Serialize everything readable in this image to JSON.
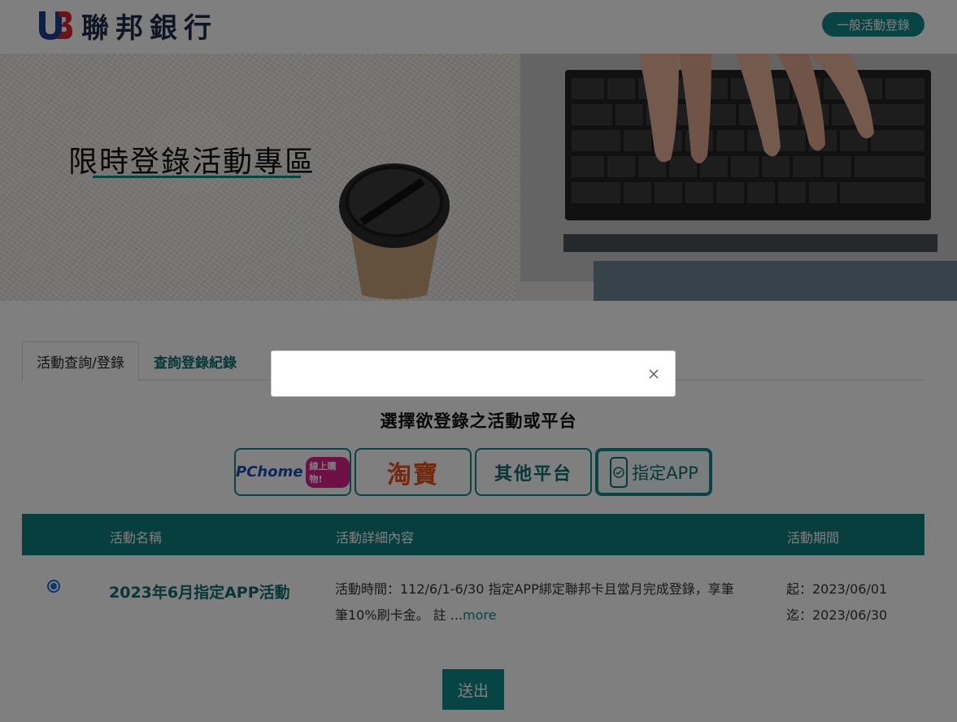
{
  "header": {
    "logo_text": "聯邦銀行",
    "general_button": "一般活動登錄"
  },
  "hero": {
    "title": "限時登錄活動專區"
  },
  "tabs": [
    {
      "label": "活動查詢/登錄",
      "active": true
    },
    {
      "label": "查詢登錄紀錄",
      "active": false
    }
  ],
  "subtitle": "選擇欲登錄之活動或平台",
  "platforms": {
    "pchome": {
      "logo": "PChome",
      "badge": "線上購物!"
    },
    "taobao": {
      "label": "淘寶"
    },
    "other": {
      "label": "其他平台"
    },
    "app": {
      "label": "指定APP",
      "selected": true
    }
  },
  "table": {
    "headers": [
      "活動名稱",
      "活動詳細內容",
      "活動期間"
    ],
    "rows": [
      {
        "selected": true,
        "name": "2023年6月指定APP活動",
        "desc_line1": "活動時間：112/6/1-6/30 指定APP綁定聯邦卡且當月完成登錄，享筆",
        "desc_line2": "筆10%刷卡金。 註 ...",
        "more": "more",
        "start": "起：2023/06/01",
        "end": "迄：2023/06/30"
      }
    ]
  },
  "submit_label": "送出",
  "colors": {
    "accent": "#0e8b8b",
    "table_header": "#0e7f7f",
    "overlay": "rgba(0,0,0,0.5)"
  },
  "icons": {
    "close": "close-icon",
    "app": "phone-check-icon"
  }
}
